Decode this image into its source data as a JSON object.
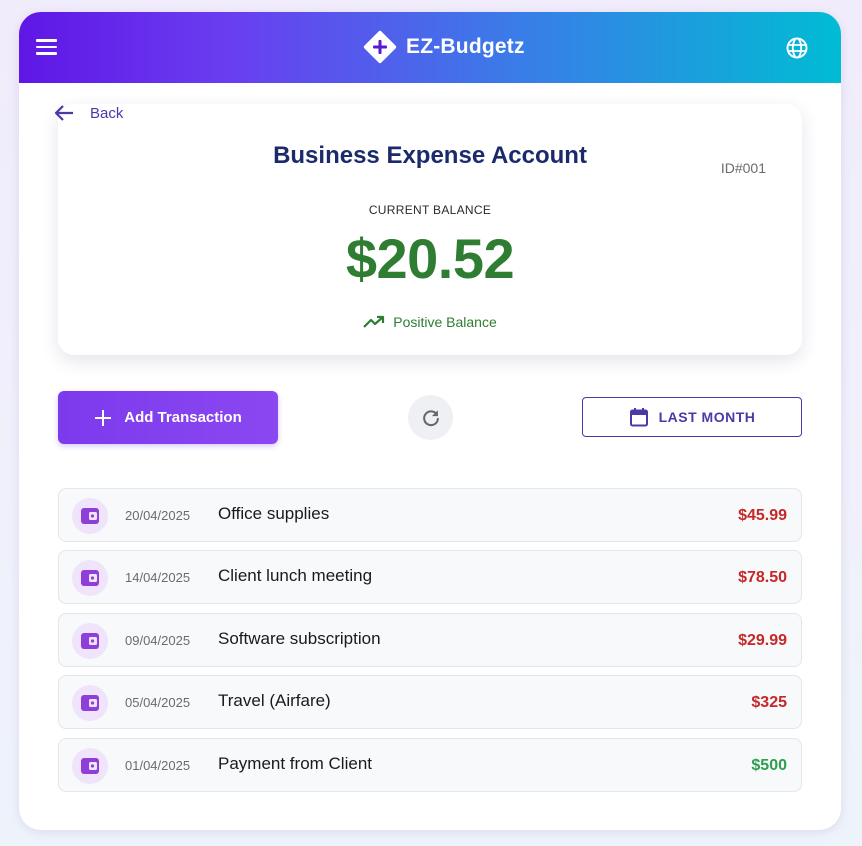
{
  "header": {
    "title": "EZ-Budgetz",
    "menu_icon": "hamburger-menu-icon",
    "language_icon": "globe-icon",
    "logo_icon": "diamond-plus-logo"
  },
  "nav": {
    "back_label": "Back"
  },
  "account": {
    "name": "Business Expense Account",
    "id": "ID#001",
    "balance_label": "CURRENT BALANCE",
    "balance": "$20.52",
    "status": "Positive Balance",
    "status_icon": "trending-up-icon"
  },
  "actions": {
    "add_label": "Add Transaction",
    "period_label": "LAST MONTH",
    "refresh_icon": "refresh-icon",
    "calendar_icon": "calendar-icon"
  },
  "colors": {
    "accent": "#7c3aed",
    "expense": "#c62828",
    "income": "#2e9e4f",
    "balance_positive": "#2e7d32"
  },
  "transactions": [
    {
      "date": "20/04/2025",
      "description": "Office supplies",
      "amount": "$45.99",
      "type": "expense"
    },
    {
      "date": "14/04/2025",
      "description": "Client lunch meeting",
      "amount": "$78.50",
      "type": "expense"
    },
    {
      "date": "09/04/2025",
      "description": "Software subscription",
      "amount": "$29.99",
      "type": "expense"
    },
    {
      "date": "05/04/2025",
      "description": "Travel (Airfare)",
      "amount": "$325",
      "type": "expense"
    },
    {
      "date": "01/04/2025",
      "description": "Payment from Client",
      "amount": "$500",
      "type": "income"
    }
  ]
}
